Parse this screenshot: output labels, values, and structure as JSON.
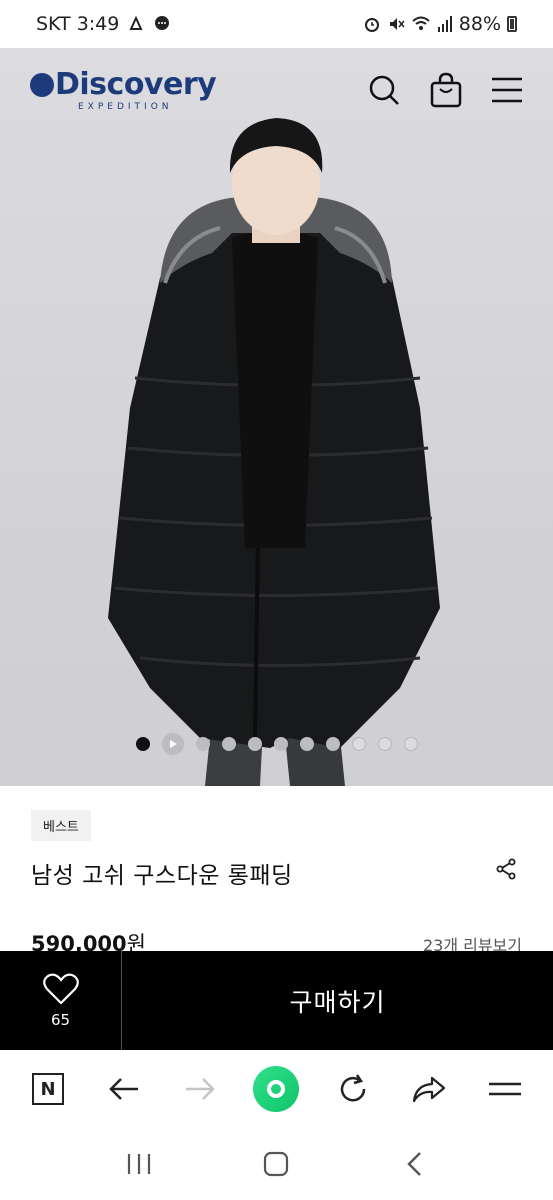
{
  "status_bar": {
    "carrier_time": "SKT 3:49",
    "battery": "88%"
  },
  "brand": {
    "logo_text": "Discovery",
    "logo_sub": "EXPEDITION",
    "color": "#1d3b7a"
  },
  "product": {
    "badge": "베스트",
    "title": "남성 고쉬 구스다운 롱패딩",
    "price": "590,000",
    "price_unit": "원",
    "reviews": "23개 리뷰보기"
  },
  "carousel": {
    "total": 11,
    "active_index": 0
  },
  "purchase_bar": {
    "wish_count": "65",
    "buy_label": "구매하기"
  },
  "browser_toolbar": {
    "home_label": "N"
  },
  "icons": {
    "header": [
      "search-icon",
      "shopping-bag-icon",
      "menu-icon"
    ],
    "browser": [
      "naver-home-icon",
      "back-arrow-icon",
      "forward-arrow-icon",
      "green-dot-icon",
      "refresh-icon",
      "share-icon",
      "menu-icon"
    ],
    "system": [
      "recent-apps-icon",
      "home-icon",
      "back-icon"
    ]
  }
}
